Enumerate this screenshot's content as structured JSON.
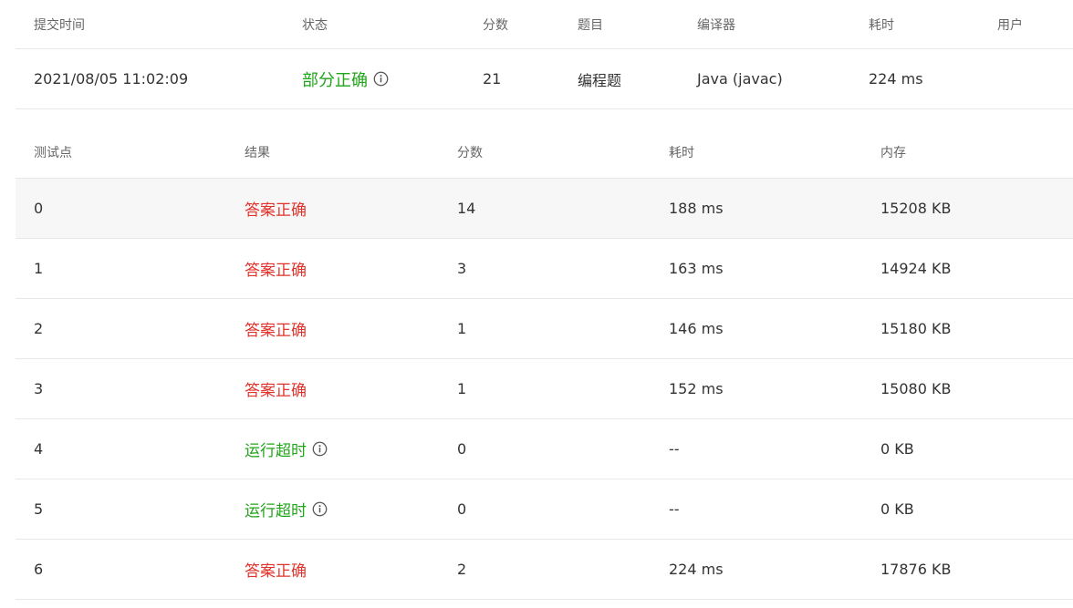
{
  "submission": {
    "headers": [
      "提交时间",
      "状态",
      "分数",
      "题目",
      "编译器",
      "耗时",
      "用户"
    ],
    "row": {
      "time": "2021/08/05 11:02:09",
      "status": "部分正确",
      "score": "21",
      "problem": "编程题",
      "compiler": "Java (javac)",
      "duration": "224 ms",
      "user": ""
    },
    "status_color": "#21a51a"
  },
  "cases": {
    "headers": [
      "测试点",
      "结果",
      "分数",
      "耗时",
      "内存"
    ],
    "rows": [
      {
        "id": "0",
        "result": "答案正确",
        "kind": "ok",
        "score": "14",
        "time": "188 ms",
        "memory": "15208 KB"
      },
      {
        "id": "1",
        "result": "答案正确",
        "kind": "ok",
        "score": "3",
        "time": "163 ms",
        "memory": "14924 KB"
      },
      {
        "id": "2",
        "result": "答案正确",
        "kind": "ok",
        "score": "1",
        "time": "146 ms",
        "memory": "15180 KB"
      },
      {
        "id": "3",
        "result": "答案正确",
        "kind": "ok",
        "score": "1",
        "time": "152 ms",
        "memory": "15080 KB"
      },
      {
        "id": "4",
        "result": "运行超时",
        "kind": "timeout",
        "score": "0",
        "time": "--",
        "memory": "0 KB"
      },
      {
        "id": "5",
        "result": "运行超时",
        "kind": "timeout",
        "score": "0",
        "time": "--",
        "memory": "0 KB"
      },
      {
        "id": "6",
        "result": "答案正确",
        "kind": "ok",
        "score": "2",
        "time": "224 ms",
        "memory": "17876 KB"
      }
    ]
  },
  "colors": {
    "accepted": "#e0332b",
    "timeout": "#21a51a",
    "border": "#e8e8e8",
    "hover_row": "#f7f7f7"
  },
  "icons": {
    "info": "info-circle-icon"
  }
}
